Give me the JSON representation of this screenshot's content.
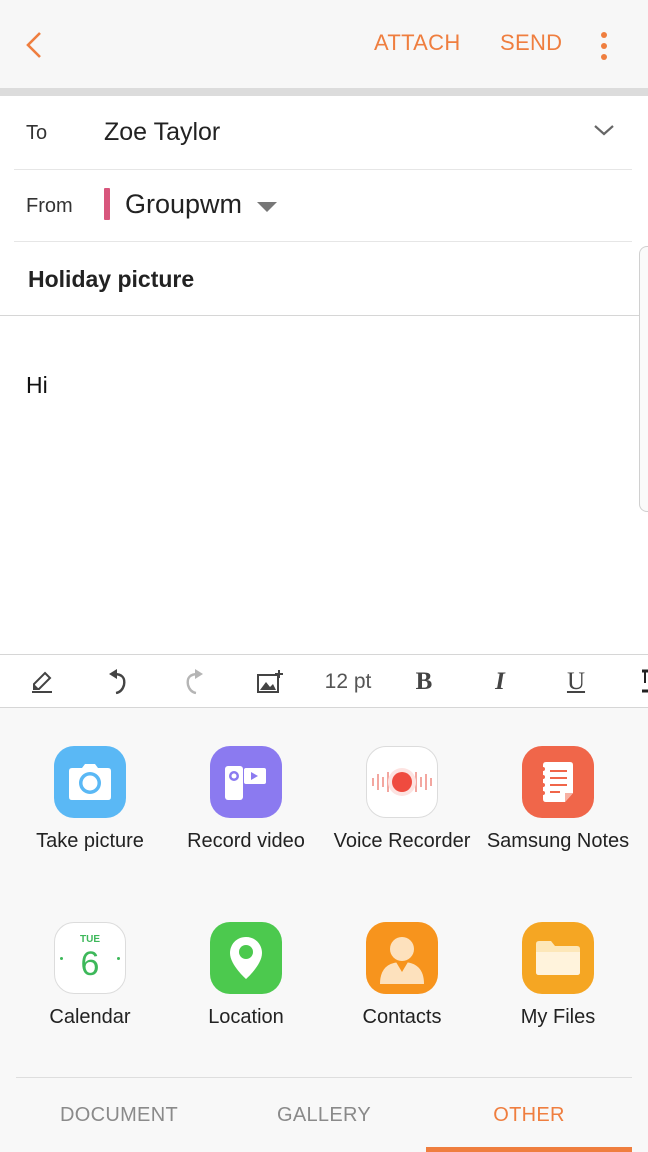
{
  "header": {
    "back_icon": "chevron-left-icon",
    "attach_label": "ATTACH",
    "send_label": "SEND",
    "more_icon": "more-vertical-icon",
    "accent_color": "#ef7e3f"
  },
  "compose": {
    "to_label": "To",
    "to_value": "Zoe Taylor",
    "from_label": "From",
    "from_value": "Groupwm",
    "from_account_color": "#d8567d",
    "subject": "Holiday picture",
    "body": "Hi"
  },
  "toolbar": {
    "font_size": "12 pt",
    "bold": "B",
    "italic": "I",
    "underline": "U"
  },
  "attach_options": [
    {
      "label": "Take picture",
      "icon": "camera-icon",
      "color": "#5ab8f5"
    },
    {
      "label": "Record video",
      "icon": "video-camera-icon",
      "color": "#8b7af0"
    },
    {
      "label": "Voice Recorder",
      "icon": "microphone-icon",
      "color": "#ffffff"
    },
    {
      "label": "Samsung Notes",
      "icon": "notes-icon",
      "color": "#f0664a"
    },
    {
      "label": "Calendar",
      "icon": "calendar-icon",
      "color": "#ffffff",
      "calendar_day": "TUE",
      "calendar_date": "6"
    },
    {
      "label": "Location",
      "icon": "location-pin-icon",
      "color": "#4cc94e"
    },
    {
      "label": "Contacts",
      "icon": "contact-icon",
      "color": "#f7941d"
    },
    {
      "label": "My Files",
      "icon": "folder-icon",
      "color": "#f5a623"
    }
  ],
  "tabs": [
    {
      "label": "DOCUMENT",
      "active": false
    },
    {
      "label": "GALLERY",
      "active": false
    },
    {
      "label": "OTHER",
      "active": true
    }
  ]
}
